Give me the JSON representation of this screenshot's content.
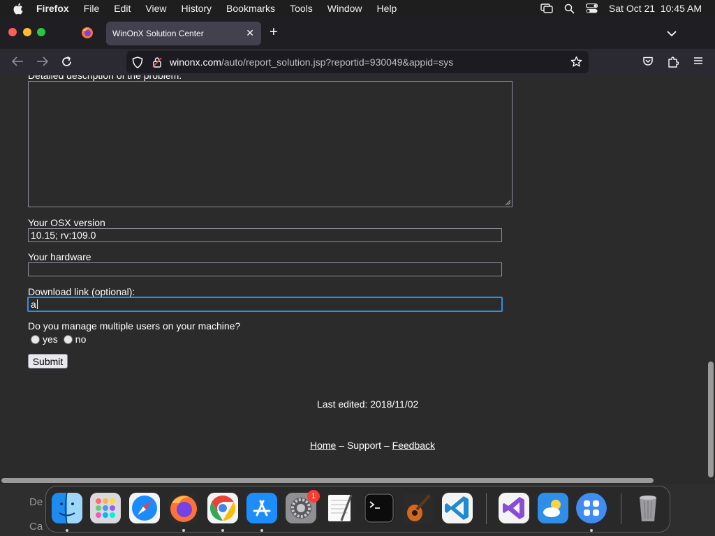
{
  "menubar": {
    "app_name": "Firefox",
    "items": [
      "File",
      "Edit",
      "View",
      "History",
      "Bookmarks",
      "Tools",
      "Window",
      "Help"
    ],
    "clock": "Sat Oct 21  10:45 AM"
  },
  "browser": {
    "tab_title": "WinOnX Solution Center",
    "url_host": "winonx.com",
    "url_path": "/auto/report_solution.jsp?reportid=930049&appid=sys"
  },
  "form": {
    "desc_label": "Detailed description of the problem:",
    "osx_label": "Your OSX version",
    "osx_value": "10.15; rv:109.0",
    "hardware_label": "Your hardware",
    "hardware_value": "",
    "download_label": "Download link (optional):",
    "download_value": "a",
    "multi_users_question": "Do you manage multiple users on your machine?",
    "opt_yes": "yes",
    "opt_no": "no",
    "submit_label": "Submit"
  },
  "page": {
    "last_edited": "Last edited: 2018/11/02",
    "footer_home": "Home",
    "footer_sep1": " – ",
    "footer_support": "Support",
    "footer_sep2": " – ",
    "footer_feedback": "Feedback"
  },
  "peek": {
    "line1": "De",
    "line2": "Ca"
  },
  "dock": {
    "settings_badge": "1",
    "apps": [
      "finder-icon",
      "launchpad-icon",
      "safari-icon",
      "firefox-icon",
      "chrome-icon",
      "app-store-icon",
      "system-settings-icon",
      "textedit-icon",
      "terminal-icon",
      "garageband-icon",
      "vscode-icon",
      "visual-studio-icon",
      "weather-icon",
      "widget-icon",
      "trash-icon"
    ]
  }
}
